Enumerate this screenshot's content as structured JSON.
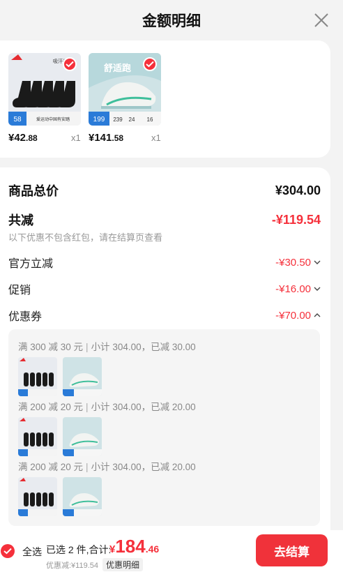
{
  "header": {
    "title": "金额明细"
  },
  "products": [
    {
      "price_int": "¥42",
      "price_dec": ".88",
      "qty": "x1",
      "image_text": [
        "吸汗透气",
        "58",
        "爱运动中国有安踏"
      ]
    },
    {
      "price_int": "¥141",
      "price_dec": ".58",
      "qty": "x1",
      "image_text": [
        "舒适跑",
        "199",
        "239",
        "24",
        "16"
      ]
    }
  ],
  "summary": {
    "total_label": "商品总价",
    "total_value": "¥304.00",
    "reduce_label": "共减",
    "reduce_value": "-¥119.54",
    "note": "以下优惠不包含红包，请在结算页查看",
    "items": [
      {
        "label": "官方立减",
        "value": "-¥30.50",
        "chevron": "chevron-down-icon"
      },
      {
        "label": "促销",
        "value": "-¥16.00",
        "chevron": "chevron-down-icon"
      },
      {
        "label": "优惠券",
        "value": "-¥70.00",
        "chevron": "chevron-up-icon"
      }
    ],
    "coupons": [
      {
        "rule": "满 300 减 30 元",
        "detail": "小计 304.00，已减 30.00"
      },
      {
        "rule": "满 200 减 20 元",
        "detail": "小计 304.00，已减 20.00"
      },
      {
        "rule": "满 200 减 20 元",
        "detail": "小计 304.00，已减 20.00"
      }
    ]
  },
  "bottom": {
    "select_all": "全选",
    "selected_text": "已选 2 件,合计:",
    "total_sym": "¥",
    "total_int": "184",
    "total_dec": ".46",
    "discount_text": "优惠减:¥119.54",
    "detail_label": "优惠明细",
    "checkout_label": "去结算"
  },
  "colors": {
    "accent": "#f5303b",
    "background": "#f3f3f3"
  }
}
